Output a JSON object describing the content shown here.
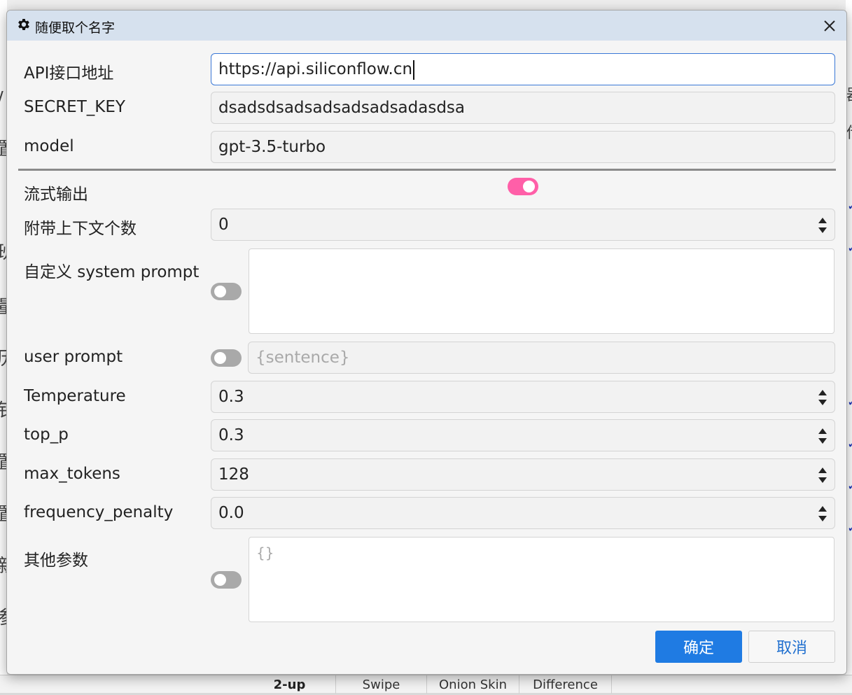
{
  "dialog": {
    "title": "随便取个名字",
    "title_icon": "gear-icon",
    "close_icon": "close-icon"
  },
  "fields": {
    "api_url": {
      "label": "API接口地址",
      "value": "https://api.siliconflow.cn"
    },
    "secret_key": {
      "label": "SECRET_KEY",
      "value": "dsadsdsadsadsadsadsadasdsa"
    },
    "model": {
      "label": "model",
      "value": "gpt-3.5-turbo"
    },
    "stream": {
      "label": "流式输出",
      "enabled": true
    },
    "context_count": {
      "label": "附带上下文个数",
      "value": "0"
    },
    "system_prompt": {
      "label": "自定义 system prompt",
      "enabled": false,
      "value": ""
    },
    "user_prompt": {
      "label": "user prompt",
      "enabled": false,
      "placeholder": "{sentence}"
    },
    "temperature": {
      "label": "Temperature",
      "value": "0.3"
    },
    "top_p": {
      "label": "top_p",
      "value": "0.3"
    },
    "max_tokens": {
      "label": "max_tokens",
      "value": "128"
    },
    "frequency_penalty": {
      "label": "frequency_penalty",
      "value": "0.0"
    },
    "other_params": {
      "label": "其他参数",
      "enabled": false,
      "placeholder": "{}"
    }
  },
  "buttons": {
    "confirm": "确定",
    "cancel": "取消"
  },
  "background": {
    "tabs": [
      "2-up",
      "Swipe",
      "Onion Skin",
      "Difference"
    ],
    "left_glyphs": [
      "/",
      "置",
      "班",
      "量",
      "历",
      "钅",
      "置",
      "置",
      "新",
      "参"
    ],
    "right_glyphs": [
      "器",
      "借"
    ]
  },
  "colors": {
    "titlebar": "#d6e1ee",
    "accent": "#1f7be3",
    "toggle_on": "#ff5fa8",
    "focus_border": "#3a78d6"
  }
}
